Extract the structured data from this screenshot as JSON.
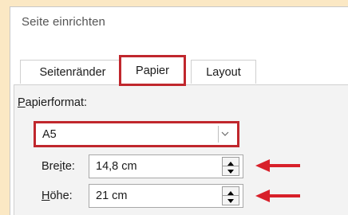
{
  "dialog": {
    "title": "Seite einrichten",
    "tabs": [
      {
        "label": "Seitenränder"
      },
      {
        "label": "Papier"
      },
      {
        "label": "Layout"
      }
    ],
    "paper_format": {
      "label_first": "P",
      "label_rest": "apierformat:",
      "selected": "A5"
    },
    "width": {
      "label_start": "Bre",
      "label_accel": "i",
      "label_end": "te:",
      "value": "14,8 cm"
    },
    "height": {
      "label_accel": "H",
      "label_rest": "öhe:",
      "value": "21 cm"
    }
  },
  "colors": {
    "highlight": "#c0272d",
    "background": "#fbe8c4"
  }
}
